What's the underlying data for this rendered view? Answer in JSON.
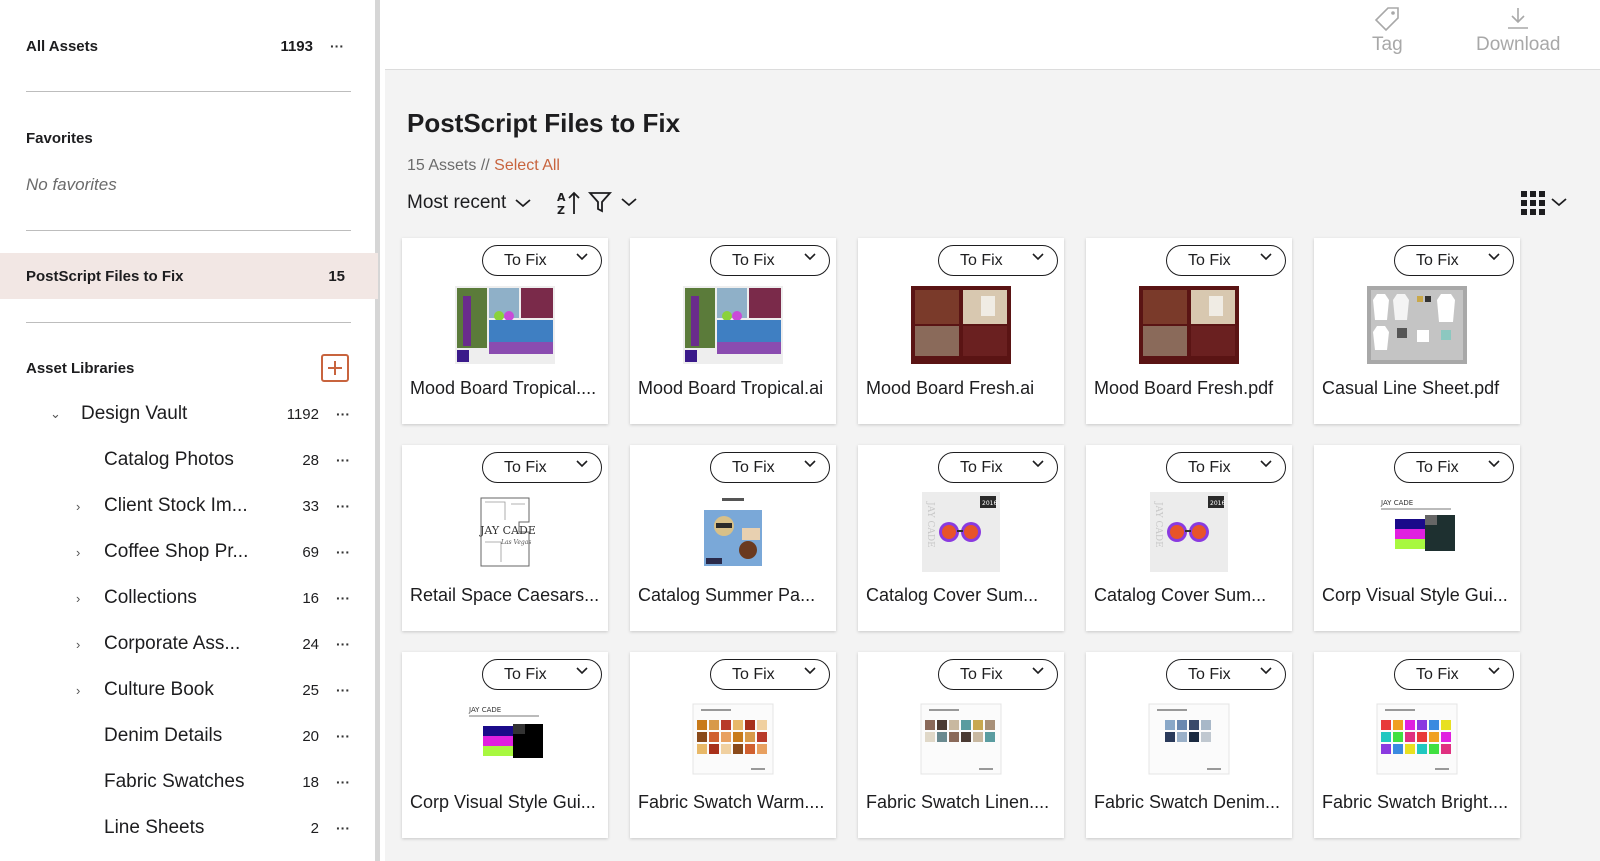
{
  "sidebar": {
    "all_assets": {
      "label": "All Assets",
      "count": "1193"
    },
    "favorites": {
      "label": "Favorites",
      "empty": "No favorites"
    },
    "active": {
      "label": "PostScript Files to Fix",
      "count": "15"
    },
    "libraries_label": "Asset Libraries",
    "library": {
      "label": "Design Vault",
      "count": "1192"
    },
    "folders": [
      {
        "label": "Catalog Photos",
        "count": "28",
        "expandable": false
      },
      {
        "label": "Client Stock Im...",
        "count": "33",
        "expandable": true
      },
      {
        "label": "Coffee Shop Pr...",
        "count": "69",
        "expandable": true
      },
      {
        "label": "Collections",
        "count": "16",
        "expandable": true
      },
      {
        "label": "Corporate Ass...",
        "count": "24",
        "expandable": true
      },
      {
        "label": "Culture Book",
        "count": "25",
        "expandable": true
      },
      {
        "label": "Denim Details",
        "count": "20",
        "expandable": false
      },
      {
        "label": "Fabric Swatches",
        "count": "18",
        "expandable": false
      },
      {
        "label": "Line Sheets",
        "count": "2",
        "expandable": false
      }
    ],
    "dots": "···"
  },
  "toolbar": {
    "tag_label": "Tag",
    "download_label": "Download"
  },
  "main": {
    "title": "PostScript Files to Fix",
    "assets_count": "15 Assets //",
    "select_all": "Select All",
    "sort_label": "Most recent"
  },
  "status_label": "To Fix",
  "assets": [
    {
      "name": "Mood Board Tropical....",
      "thumb": "tropical"
    },
    {
      "name": "Mood Board Tropical.ai",
      "thumb": "tropical"
    },
    {
      "name": "Mood Board Fresh.ai",
      "thumb": "fresh"
    },
    {
      "name": "Mood Board Fresh.pdf",
      "thumb": "fresh"
    },
    {
      "name": "Casual Line Sheet.pdf",
      "thumb": "linesheet"
    },
    {
      "name": "Retail Space Caesars...",
      "thumb": "retail"
    },
    {
      "name": "Catalog Summer Pa...",
      "thumb": "summer"
    },
    {
      "name": "Catalog Cover Sum...",
      "thumb": "cover"
    },
    {
      "name": "Catalog Cover Sum...",
      "thumb": "cover"
    },
    {
      "name": "Corp Visual Style Gui...",
      "thumb": "style"
    },
    {
      "name": "Corp Visual Style Gui...",
      "thumb": "style2"
    },
    {
      "name": "Fabric Swatch Warm....",
      "thumb": "warm"
    },
    {
      "name": "Fabric Swatch Linen....",
      "thumb": "linen"
    },
    {
      "name": "Fabric Swatch Denim...",
      "thumb": "denim"
    },
    {
      "name": "Fabric Swatch Bright....",
      "thumb": "bright"
    }
  ],
  "colors": {
    "accent": "#c8643e",
    "active_bg": "#f2e7e4"
  }
}
